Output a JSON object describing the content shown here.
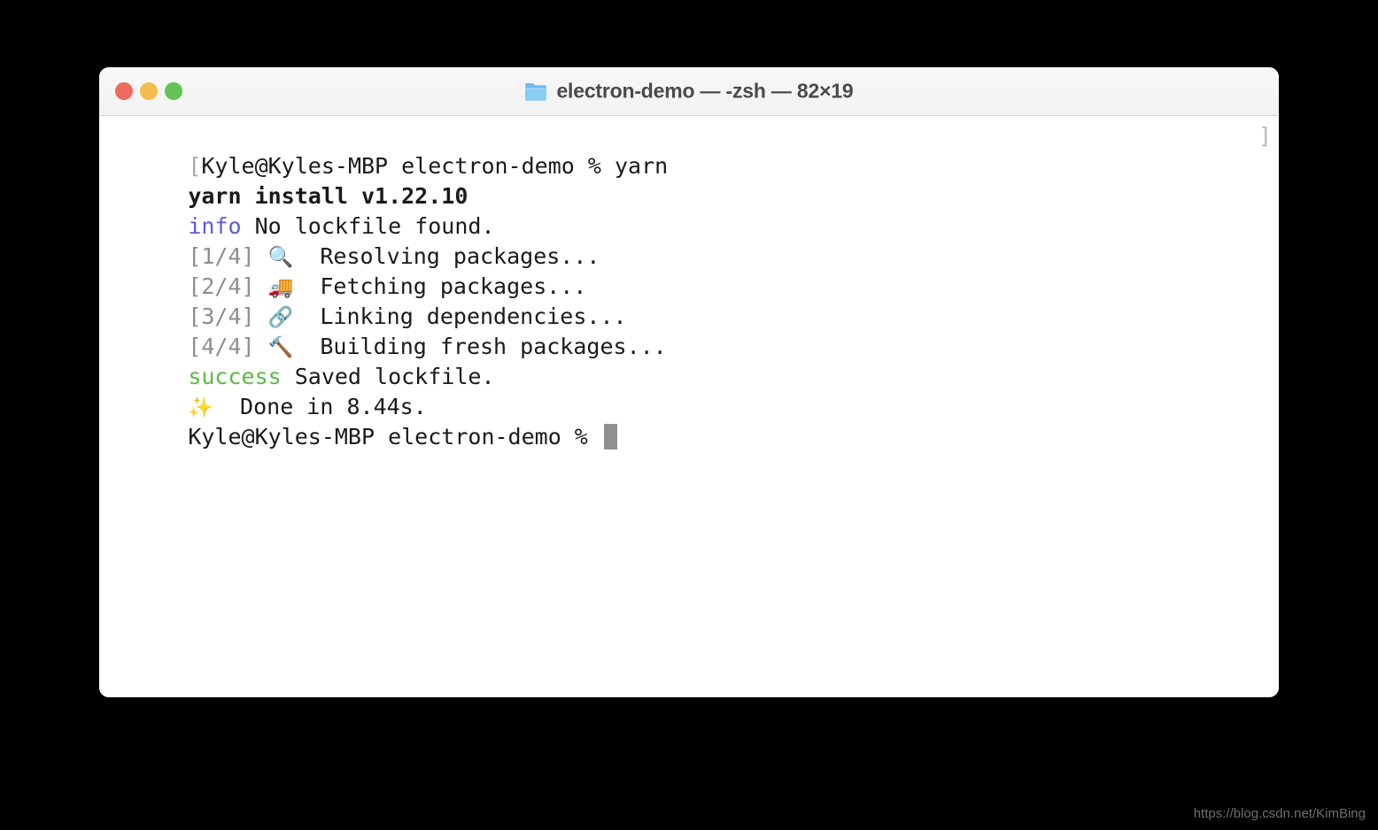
{
  "window": {
    "title": "electron-demo — -zsh — 82×19",
    "folder_icon": "folder-icon",
    "traffic_lights": [
      {
        "name": "close",
        "label": "Close",
        "color": "#ec6a5f"
      },
      {
        "name": "minimize",
        "label": "Minimize",
        "color": "#f4bd4f"
      },
      {
        "name": "zoom",
        "label": "Zoom",
        "color": "#61c454"
      }
    ]
  },
  "terminal": {
    "colors": {
      "background": "#ffffff",
      "foreground": "#1a1a1a",
      "info": "#5b5bdd",
      "success": "#5cb947",
      "step_counter": "#8e8e8e",
      "bracket": "#b9b9b9",
      "cursor": "#909090"
    },
    "lines": [
      {
        "leading_bracket": "[",
        "text": "Kyle@Kyles-MBP electron-demo % yarn",
        "trailing_bracket": "]"
      },
      {
        "text": "yarn install v1.22.10"
      },
      {
        "tag": "info",
        "text": " No lockfile found."
      },
      {
        "step": "[1/4]",
        "icon": "🔍",
        "text": "  Resolving packages..."
      },
      {
        "step": "[2/4]",
        "icon": "🚚",
        "text": "  Fetching packages..."
      },
      {
        "step": "[3/4]",
        "icon": "🔗",
        "text": "  Linking dependencies..."
      },
      {
        "step": "[4/4]",
        "icon": "🔨",
        "text": "  Building fresh packages..."
      },
      {
        "tag": "success",
        "text": " Saved lockfile."
      },
      {
        "icon": "✨",
        "text": "  Done in 8.44s."
      },
      {
        "text": "Kyle@Kyles-MBP electron-demo % "
      }
    ]
  },
  "watermark": {
    "text": "https://blog.csdn.net/KimBing"
  }
}
